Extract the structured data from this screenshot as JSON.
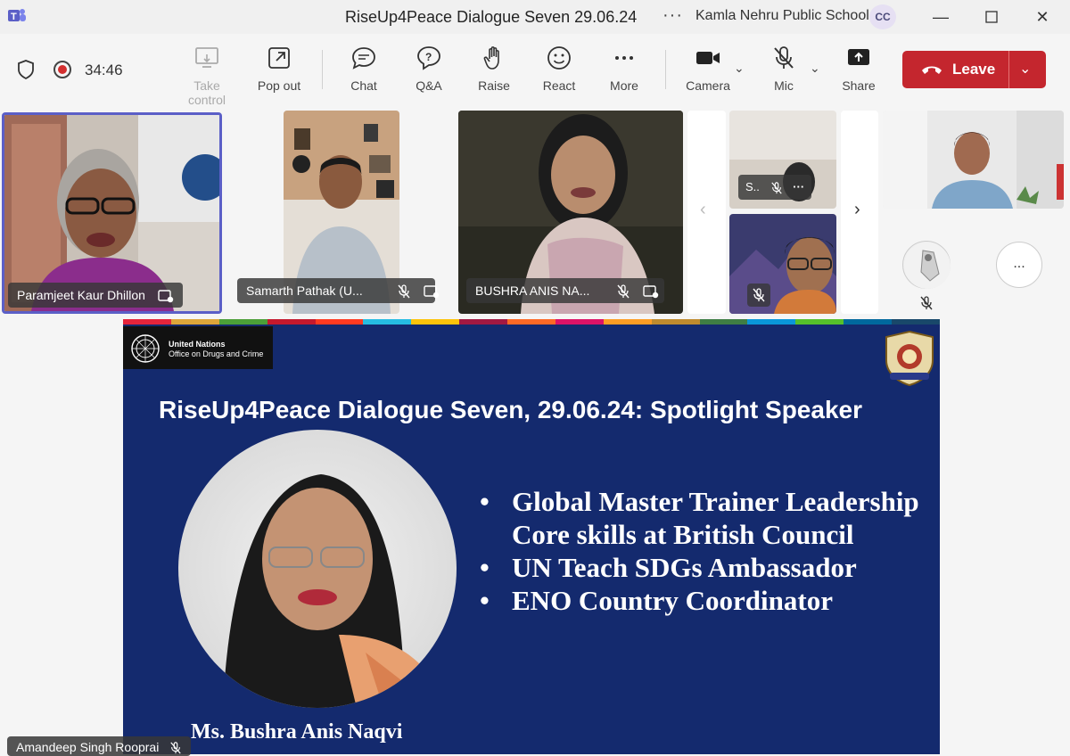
{
  "window": {
    "title": "RiseUp4Peace Dialogue Seven 29.06.24",
    "more_icon": "ellipsis-icon",
    "org": "Kamla Nehru Public School",
    "avatar_initials": "CC"
  },
  "toolbar": {
    "timer": "34:46",
    "buttons": [
      {
        "label": "Take control",
        "icon": "take-control-icon"
      },
      {
        "label": "Pop out",
        "icon": "pop-out-icon"
      },
      {
        "label": "Chat",
        "icon": "chat-icon"
      },
      {
        "label": "Q&A",
        "icon": "qna-icon"
      },
      {
        "label": "Raise",
        "icon": "hand-icon"
      },
      {
        "label": "React",
        "icon": "smile-icon"
      },
      {
        "label": "More",
        "icon": "more-icon"
      },
      {
        "label": "Camera",
        "icon": "camera-icon"
      },
      {
        "label": "Mic",
        "icon": "mic-off-icon"
      },
      {
        "label": "Share",
        "icon": "share-icon"
      }
    ],
    "leave_label": "Leave",
    "leave_color": "#c4262e"
  },
  "participants": [
    {
      "name": "Paramjeet Kaur Dhillon"
    },
    {
      "name": "Samarth Pathak (U..."
    },
    {
      "name": "BUSHRA ANIS NA..."
    },
    {
      "name": "S.."
    },
    {
      "name": ""
    },
    {
      "name": ""
    }
  ],
  "overflow_button": "...",
  "slide": {
    "org_line1": "United Nations",
    "org_line2": "Office on Drugs and Crime",
    "title": "RiseUp4Peace Dialogue Seven, 29.06.24: Spotlight Speaker",
    "bullets": [
      "Global Master Trainer Leadership Core skills at British Council",
      "UN Teach SDGs Ambassador",
      "ENO Country Coordinator"
    ],
    "speaker": "Ms. Bushra Anis Naqvi",
    "background": "#142a6e"
  },
  "presenter": {
    "name": "Amandeep Singh Rooprai"
  },
  "colors": {
    "accent": "#5b5fc7",
    "leave": "#c4262e"
  }
}
